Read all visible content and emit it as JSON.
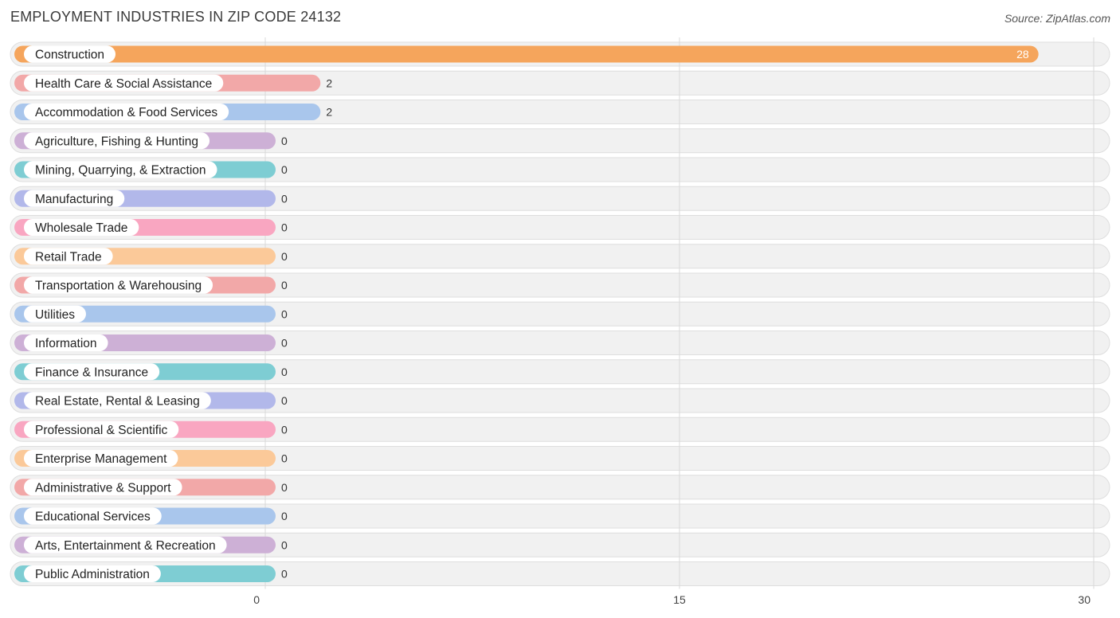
{
  "chart_data": {
    "type": "bar",
    "orientation": "horizontal",
    "title": "EMPLOYMENT INDUSTRIES IN ZIP CODE 24132",
    "source": "Source: ZipAtlas.com",
    "xlim": [
      0,
      30
    ],
    "xticks": [
      0,
      15,
      30
    ],
    "grid": true,
    "categories": [
      "Construction",
      "Health Care & Social Assistance",
      "Accommodation & Food Services",
      "Agriculture, Fishing & Hunting",
      "Mining, Quarrying, & Extraction",
      "Manufacturing",
      "Wholesale Trade",
      "Retail Trade",
      "Transportation & Warehousing",
      "Utilities",
      "Information",
      "Finance & Insurance",
      "Real Estate, Rental & Leasing",
      "Professional & Scientific",
      "Enterprise Management",
      "Administrative & Support",
      "Educational Services",
      "Arts, Entertainment & Recreation",
      "Public Administration"
    ],
    "values": [
      28,
      2,
      2,
      0,
      0,
      0,
      0,
      0,
      0,
      0,
      0,
      0,
      0,
      0,
      0,
      0,
      0,
      0,
      0
    ],
    "colors": [
      "#f5a55c",
      "#f2a8a8",
      "#a9c6ec",
      "#cdb0d6",
      "#7ecdd3",
      "#b2b8ea",
      "#f9a6c1",
      "#fbc999",
      "#f2a8a8",
      "#a9c6ec",
      "#cdb0d6",
      "#7ecdd3",
      "#b2b8ea",
      "#f9a6c1",
      "#fbc999",
      "#f2a8a8",
      "#a9c6ec",
      "#cdb0d6",
      "#7ecdd3"
    ]
  }
}
